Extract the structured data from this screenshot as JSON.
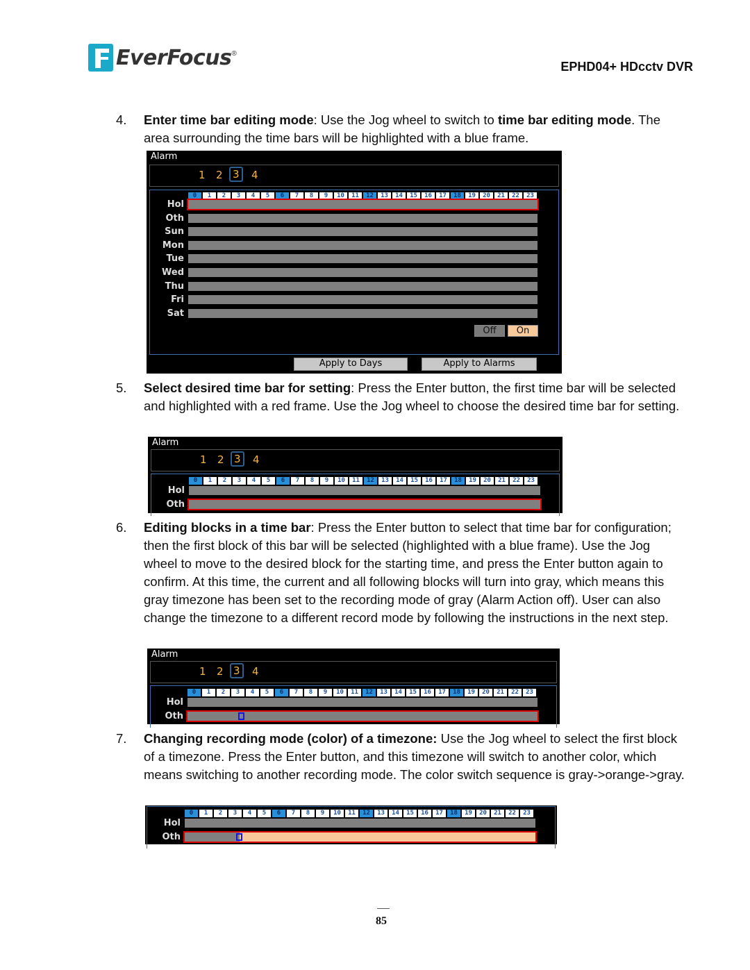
{
  "header": {
    "logo_text": "EverFocus",
    "logo_reg": "®",
    "doc_title": "EPHD04+  HDcctv DVR"
  },
  "steps": [
    {
      "num": "4.",
      "bold": "Enter time bar editing mode",
      "text1": ": Use the Jog wheel to switch to ",
      "bold2": "time bar editing mode",
      "text2": ". The area surrounding the time bars will be highlighted with a blue frame."
    },
    {
      "num": "5.",
      "bold": "Select desired time bar for setting",
      "text1": ": Press the Enter button, the first time bar will be selected and highlighted with a red frame. Use the Jog wheel to choose the desired time bar for setting."
    },
    {
      "num": "6.",
      "bold": "Editing blocks in a time bar",
      "text1": ": Press the Enter button to select that time bar for configuration; then the first block of this bar will be selected (highlighted with a blue frame). Use the Jog wheel to move to the desired block for the starting time, and press the Enter button again to confirm. At this time, the current and all following blocks will turn into gray, which means this gray timezone has been set to the recording mode of gray (Alarm Action off).  User can also change the timezone to a different record mode by following the instructions in the next step."
    },
    {
      "num": "7.",
      "bold": "Changing recording mode (color) of a timezone:",
      "text1": " Use the Jog wheel to select the first block of a timezone. Press the Enter button, and this timezone will switch to another color, which means switching to another recording mode. The color switch sequence is gray->orange->gray."
    }
  ],
  "dvr": {
    "title": "Alarm",
    "alarms": [
      "1",
      "2",
      "3",
      "4"
    ],
    "selected_alarm": "3",
    "hours": [
      "0",
      "1",
      "2",
      "3",
      "4",
      "5",
      "6",
      "7",
      "8",
      "9",
      "10",
      "11",
      "12",
      "13",
      "14",
      "15",
      "16",
      "17",
      "18",
      "19",
      "20",
      "21",
      "22",
      "23"
    ],
    "highlight_hours": [
      "0",
      "6",
      "12",
      "18"
    ],
    "rows": [
      "Hol",
      "Oth",
      "Sun",
      "Mon",
      "Tue",
      "Wed",
      "Thu",
      "Fri",
      "Sat"
    ],
    "off_label": "Off",
    "on_label": "On",
    "apply_days": "Apply to Days",
    "apply_alarms": "Apply to Alarms"
  },
  "colors": {
    "gray_mode": "#808080",
    "orange_mode": "#f8c99a",
    "selection_red": "#dd0000",
    "selection_blue": "#1515e0"
  },
  "footer": {
    "page_number": "85"
  }
}
